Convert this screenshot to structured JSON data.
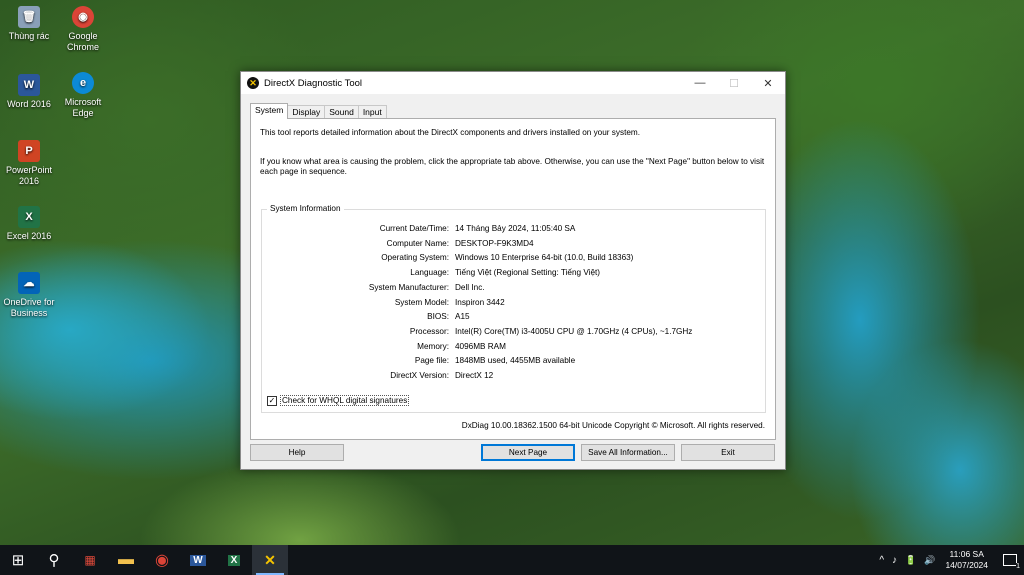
{
  "desktop": {
    "icons": [
      {
        "label": "Thùng rác",
        "color": "#7a8fa6",
        "glyph": "🗑"
      },
      {
        "label": "Google Chrome",
        "color": "#db4437",
        "glyph": "◉"
      },
      {
        "label": "Word 2016",
        "color": "#2b579a",
        "glyph": "W"
      },
      {
        "label": "Microsoft Edge",
        "color": "#0c8ad6",
        "glyph": "e"
      },
      {
        "label": "PowerPoint 2016",
        "color": "#d04423",
        "glyph": "P"
      },
      {
        "label": "Excel 2016",
        "color": "#217346",
        "glyph": "X"
      },
      {
        "label": "OneDrive for Business",
        "color": "#0364b8",
        "glyph": "☁"
      }
    ]
  },
  "window": {
    "title": "DirectX Diagnostic Tool",
    "minimize": "—",
    "maximize": "☐",
    "close": "✕",
    "tabs": [
      "System",
      "Display",
      "Sound",
      "Input"
    ],
    "intro1": "This tool reports detailed information about the DirectX components and drivers installed on your system.",
    "intro2": "If you know what area is causing the problem, click the appropriate tab above.  Otherwise, you can use the \"Next Page\" button below to visit each page in sequence.",
    "group_title": "System Information",
    "rows": [
      {
        "label": "Current Date/Time:",
        "value": "14 Tháng Bảy 2024, 11:05:40 SA"
      },
      {
        "label": "Computer Name:",
        "value": "DESKTOP-F9K3MD4"
      },
      {
        "label": "Operating System:",
        "value": "Windows 10 Enterprise 64-bit (10.0, Build 18363)"
      },
      {
        "label": "Language:",
        "value": "Tiếng Việt (Regional Setting: Tiếng Việt)"
      },
      {
        "label": "System Manufacturer:",
        "value": "Dell Inc."
      },
      {
        "label": "System Model:",
        "value": "Inspiron 3442"
      },
      {
        "label": "BIOS:",
        "value": "A15"
      },
      {
        "label": "Processor:",
        "value": "Intel(R) Core(TM) i3-4005U CPU @ 1.70GHz (4 CPUs), ~1.7GHz"
      },
      {
        "label": "Memory:",
        "value": "4096MB RAM"
      },
      {
        "label": "Page file:",
        "value": "1848MB used, 4455MB available"
      },
      {
        "label": "DirectX Version:",
        "value": "DirectX 12"
      }
    ],
    "whql_label": "Check for WHQL digital signatures",
    "whql_checked": "✓",
    "copyright": "DxDiag 10.00.18362.1500 64-bit Unicode  Copyright © Microsoft. All rights reserved.",
    "buttons": {
      "help": "Help",
      "next": "Next Page",
      "save": "Save All Information...",
      "exit": "Exit"
    }
  },
  "taskbar": {
    "start": "⊞",
    "search": "⚲",
    "apps": [
      {
        "name": "app-red",
        "glyph": "▦",
        "color": "#e04a3a"
      },
      {
        "name": "file-explorer",
        "glyph": "▬",
        "color": "#f2c14e"
      },
      {
        "name": "chrome",
        "glyph": "◉",
        "color": "#db4437"
      },
      {
        "name": "word",
        "glyph": "W",
        "color": "#2b579a"
      },
      {
        "name": "excel",
        "glyph": "X",
        "color": "#217346"
      },
      {
        "name": "directx",
        "glyph": "✕",
        "color": "#f5c400"
      }
    ],
    "tray_icons": [
      "^",
      "♪",
      "🔋",
      "🔊"
    ],
    "time": "11:06 SA",
    "date": "14/07/2024",
    "notifications": "1"
  }
}
